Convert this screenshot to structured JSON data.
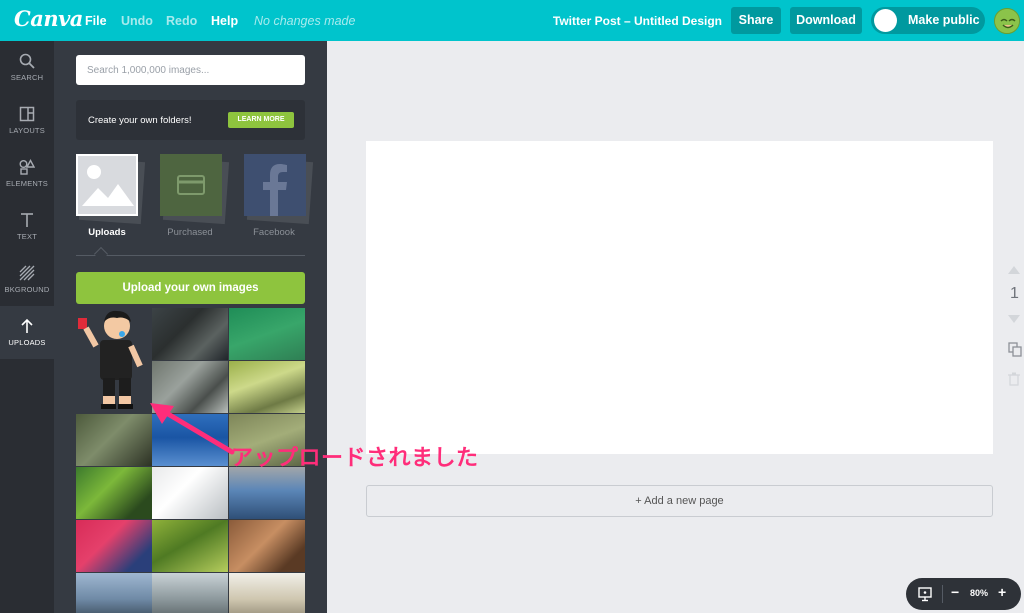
{
  "topbar": {
    "logo": "Canva",
    "menu": {
      "file": "File",
      "undo": "Undo",
      "redo": "Redo",
      "help": "Help"
    },
    "save_status": "No changes made",
    "design_title": "Twitter Post – Untitled Design",
    "share_label": "Share",
    "download_label": "Download",
    "make_public_label": "Make public"
  },
  "rail": {
    "items": [
      {
        "label": "SEARCH",
        "icon": "search-icon"
      },
      {
        "label": "LAYOUTS",
        "icon": "layouts-icon"
      },
      {
        "label": "ELEMENTS",
        "icon": "elements-icon"
      },
      {
        "label": "TEXT",
        "icon": "text-icon"
      },
      {
        "label": "BKGROUND",
        "icon": "background-icon"
      },
      {
        "label": "UPLOADS",
        "icon": "upload-arrow-icon"
      }
    ],
    "active": "UPLOADS"
  },
  "panel": {
    "search_placeholder": "Search 1,000,000 images...",
    "folders_text": "Create your own folders!",
    "learn_more": "LEARN MORE",
    "tabs": [
      {
        "label": "Uploads",
        "active": true
      },
      {
        "label": "Purchased",
        "active": false
      },
      {
        "label": "Facebook",
        "active": false
      }
    ],
    "upload_button": "Upload your own images"
  },
  "canvas": {
    "add_page": "+ Add a new page",
    "page_number": "1"
  },
  "zoom": {
    "value": "80%",
    "minus": "−",
    "plus": "+"
  },
  "annotation": {
    "text": "アップロードされました",
    "color": "#ff2d7a"
  },
  "colors": {
    "brand": "#00c4cc",
    "green": "#8ec43e",
    "rail": "#2a2d33",
    "panel": "#353a42"
  }
}
